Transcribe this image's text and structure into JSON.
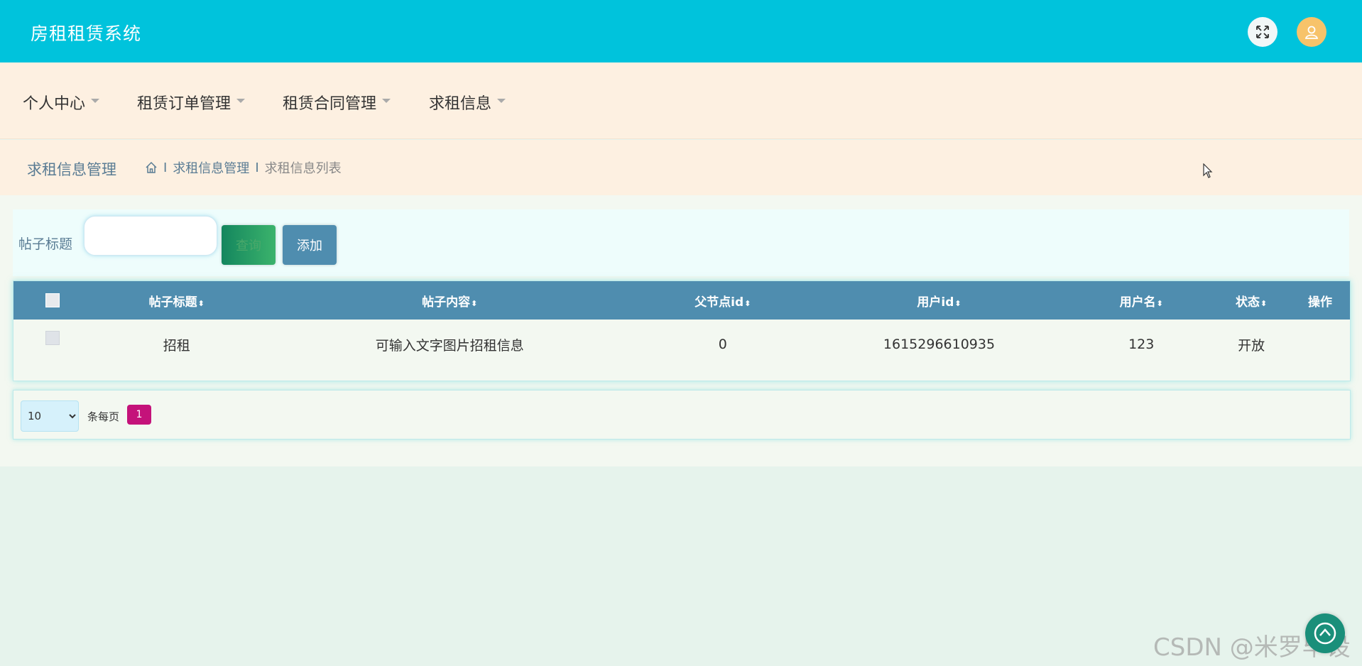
{
  "header": {
    "title": "房租租赁系统",
    "fullscreen_icon": "expand-arrows-icon",
    "avatar_icon": "user-icon"
  },
  "nav": {
    "items": [
      {
        "label": "个人中心"
      },
      {
        "label": "租赁订单管理"
      },
      {
        "label": "租赁合同管理"
      },
      {
        "label": "求租信息"
      }
    ]
  },
  "breadcrumb": {
    "section_title": "求租信息管理",
    "home_icon": "home-icon",
    "separator": "I",
    "items": [
      "求租信息管理",
      "求租信息列表"
    ]
  },
  "search": {
    "label": "帖子标题",
    "value": "",
    "query_button": "查询",
    "add_button": "添加"
  },
  "table": {
    "columns": [
      "帖子标题",
      "帖子内容",
      "父节点id",
      "用户id",
      "用户名",
      "状态",
      "操作"
    ],
    "sort_glyph": "⬍",
    "rows": [
      {
        "title": "招租",
        "content": "可输入文字图片招租信息",
        "parent_id": "0",
        "user_id": "1615296610935",
        "username": "123",
        "status": "开放",
        "actions": ""
      }
    ]
  },
  "pagination": {
    "page_size": "10",
    "page_size_options": [
      "10"
    ],
    "per_page_label": "条每页",
    "current_page": "1"
  },
  "watermark": "CSDN @米罗毕设",
  "colors": {
    "header_bg": "#00c3dc",
    "nav_bg": "#fdf0e1",
    "table_header_bg": "#4f8daf",
    "page_active": "#c4127a",
    "add_button": "#4f8daf"
  }
}
